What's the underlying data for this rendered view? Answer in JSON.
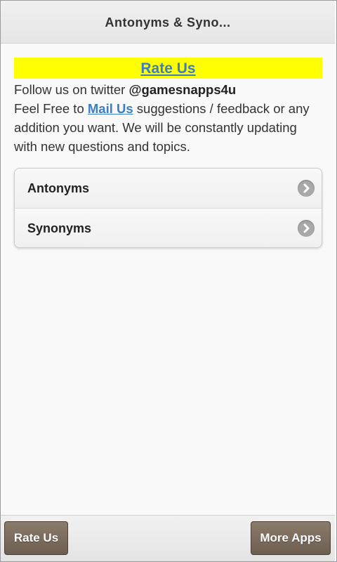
{
  "header": {
    "title": "Antonyms & Syno..."
  },
  "banner": {
    "rate_label": "Rate Us"
  },
  "info": {
    "follow_prefix": "Follow us on twitter ",
    "twitter_handle": "@gamesnapps4u",
    "feel_free_prefix": "Feel Free to ",
    "mail_link": "Mail Us",
    "feel_free_rest": " suggestions / feedback or any addition you want. We will be constantly updating with new questions and topics."
  },
  "list": {
    "items": [
      {
        "label": "Antonyms",
        "icon": "chevron-right-icon"
      },
      {
        "label": "Synonyms",
        "icon": "chevron-right-icon"
      }
    ]
  },
  "footer": {
    "left_button": "Rate Us",
    "right_button": "More Apps"
  },
  "colors": {
    "banner_bg": "#ffff00",
    "link": "#3a7fc4",
    "button_bg": "#7a6a5b"
  }
}
